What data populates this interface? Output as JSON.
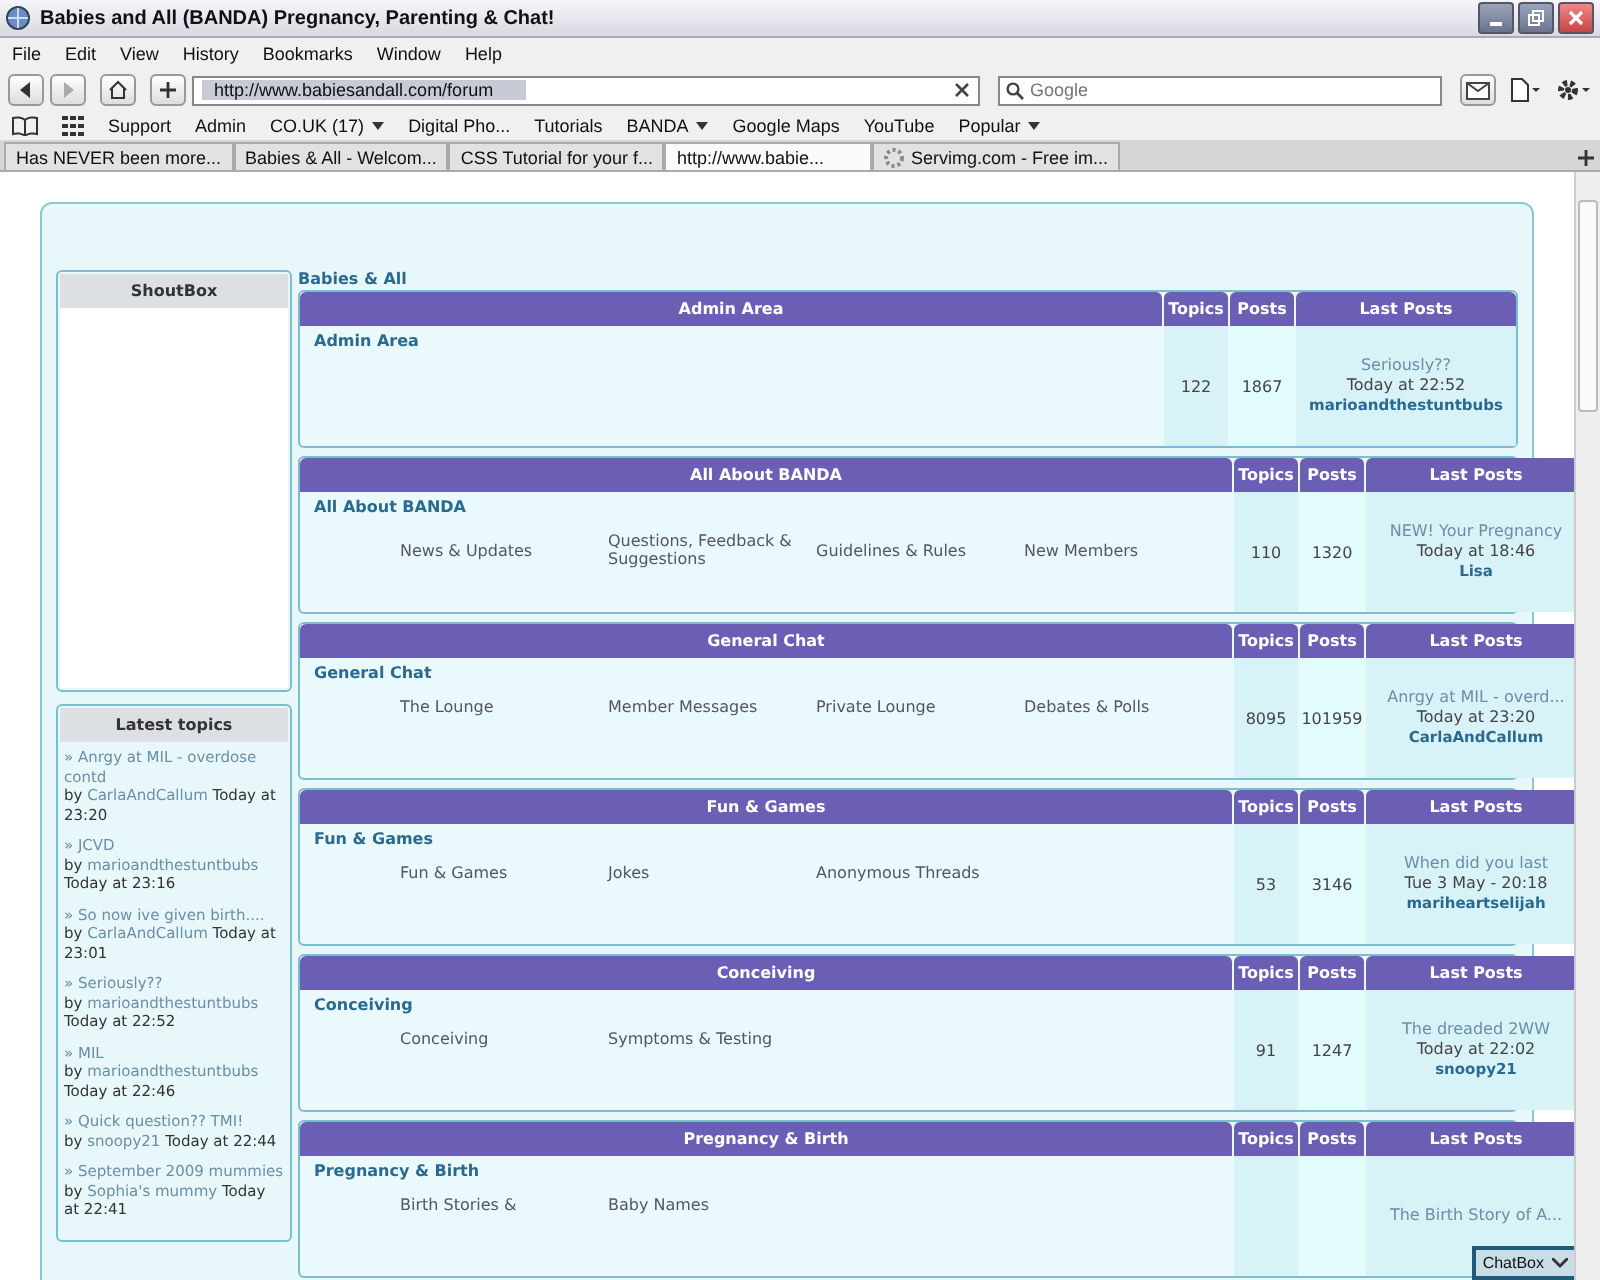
{
  "window": {
    "title": "Babies and All (BANDA) Pregnancy, Parenting & Chat!"
  },
  "menu": [
    "File",
    "Edit",
    "View",
    "History",
    "Bookmarks",
    "Window",
    "Help"
  ],
  "address": {
    "value": "http://www.babiesandall.com/forum"
  },
  "search": {
    "placeholder": "Google"
  },
  "bookmarks": [
    {
      "label": "Support",
      "dropdown": false
    },
    {
      "label": "Admin",
      "dropdown": false
    },
    {
      "label": "CO.UK (17)",
      "dropdown": true
    },
    {
      "label": "Digital Pho...",
      "dropdown": false
    },
    {
      "label": "Tutorials",
      "dropdown": false
    },
    {
      "label": "BANDA",
      "dropdown": true
    },
    {
      "label": "Google Maps",
      "dropdown": false
    },
    {
      "label": "YouTube",
      "dropdown": false
    },
    {
      "label": "Popular",
      "dropdown": true
    }
  ],
  "tabs": [
    {
      "label": "Has NEVER been more...",
      "selected": false,
      "loading": false
    },
    {
      "label": "Babies & All - Welcom...",
      "selected": false,
      "loading": false
    },
    {
      "label": "CSS Tutorial for your f...",
      "selected": false,
      "loading": false
    },
    {
      "label": "http://www.babie...",
      "selected": true,
      "loading": false
    },
    {
      "label": "Servimg.com - Free im...",
      "selected": false,
      "loading": true
    }
  ],
  "shoutbox": {
    "title": "ShoutBox"
  },
  "latest_topics": {
    "title": "Latest topics",
    "items": [
      {
        "title": "» Anrgy at MIL - overdose contd",
        "by": "by",
        "author": "CarlaAndCallum",
        "time": "Today at 23:20"
      },
      {
        "title": "» JCVD",
        "by": "by",
        "author": "marioandthestuntbubs",
        "time": "Today at 23:16"
      },
      {
        "title": "» So now ive given birth....",
        "by": "by",
        "author": "CarlaAndCallum",
        "time": "Today at 23:01"
      },
      {
        "title": "» Seriously??",
        "by": "by",
        "author": "marioandthestuntbubs",
        "time": "Today at 22:52"
      },
      {
        "title": "» MIL",
        "by": "by",
        "author": "marioandthestuntbubs",
        "time": "Today at 22:46"
      },
      {
        "title": "» Quick question?? TMI!",
        "by": "by",
        "author": "snoopy21",
        "time": "Today at 22:44"
      },
      {
        "title": "» September 2009 mummies",
        "by": "by",
        "author": "Sophia's mummy",
        "time": "Today at 22:41"
      }
    ]
  },
  "breadcrumb": "Babies & All",
  "sections": [
    {
      "title": "Admin Area",
      "headers": [
        "Topics",
        "Posts",
        "Last Posts"
      ],
      "category": "Admin Area",
      "topics": "122",
      "posts": "1867",
      "last_title": "Seriously??",
      "last_time": "Today at 22:52",
      "last_author": "marioandthestuntbubs"
    },
    {
      "title": "All About BANDA",
      "headers": [
        "Topics",
        "Posts",
        "Last Posts"
      ],
      "category": "All About BANDA",
      "subforums": [
        "News & Updates",
        "Questions, Feedback & Suggestions",
        "Guidelines & Rules",
        "New Members"
      ],
      "topics": "110",
      "posts": "1320",
      "last_title": "NEW! Your Pregnancy",
      "last_time": "Today at 18:46",
      "last_author": "Lisa"
    },
    {
      "title": "General Chat",
      "headers": [
        "Topics",
        "Posts",
        "Last Posts"
      ],
      "category": "General Chat",
      "subforums": [
        "The Lounge",
        "Member Messages",
        "Private Lounge",
        "Debates & Polls"
      ],
      "topics": "8095",
      "posts": "101959",
      "last_title": "Anrgy at MIL - overd...",
      "last_time": "Today at 23:20",
      "last_author": "CarlaAndCallum"
    },
    {
      "title": "Fun & Games",
      "headers": [
        "Topics",
        "Posts",
        "Last Posts"
      ],
      "category": "Fun & Games",
      "subforums": [
        "Fun & Games",
        "Jokes",
        "Anonymous Threads"
      ],
      "topics": "53",
      "posts": "3146",
      "last_title": "When did you last",
      "last_time": "Tue 3 May - 20:18",
      "last_author": "mariheartselijah"
    },
    {
      "title": "Conceiving",
      "headers": [
        "Topics",
        "Posts",
        "Last Posts"
      ],
      "category": "Conceiving",
      "subforums": [
        "Conceiving",
        "Symptoms & Testing"
      ],
      "topics": "91",
      "posts": "1247",
      "last_title": "The dreaded 2WW",
      "last_time": "Today at 22:02",
      "last_author": "snoopy21"
    },
    {
      "title": "Pregnancy & Birth",
      "headers": [
        "Topics",
        "Posts",
        "Last Posts"
      ],
      "category": "Pregnancy & Birth",
      "subforums": [
        "Birth Stories &",
        "Baby Names"
      ],
      "last_title": "The Birth Story of A..."
    }
  ],
  "chatbox": "ChatBox"
}
